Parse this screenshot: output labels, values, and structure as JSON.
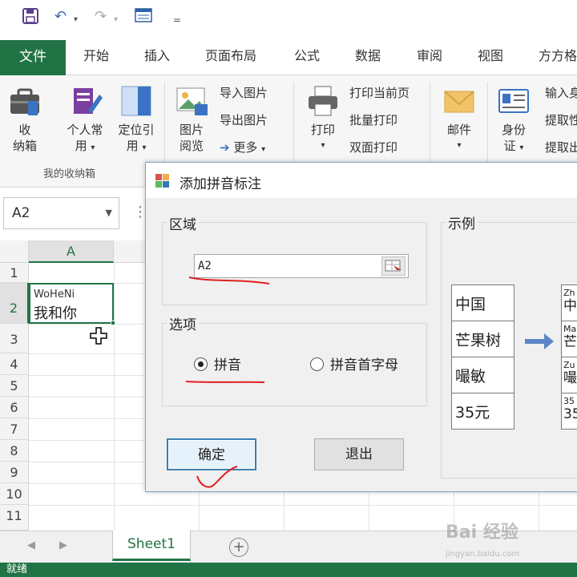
{
  "app": {
    "accent": "#217346",
    "ribbon_tabs": [
      "文件",
      "开始",
      "插入",
      "页面布局",
      "公式",
      "数据",
      "审阅",
      "视图",
      "方方格"
    ],
    "ribbon": {
      "storage_button": "收\n纳箱",
      "storage_button_l1": "收",
      "storage_button_l2": "纳箱",
      "personal_l1": "个人常",
      "personal_l2": "用",
      "locate_l1": "定位引",
      "locate_l2": "用",
      "group_label": "我的收纳箱",
      "picture_l1": "图片",
      "picture_l2": "阅览",
      "import_picture": "导入图片",
      "export_picture": "导出图片",
      "more": "更多",
      "print": "打印",
      "print_current": "打印当前页",
      "batch_print": "批量打印",
      "duplex_print": "双面打印",
      "mail": "邮件",
      "id_l1": "身份",
      "id_l2": "证",
      "input_id": "输入身",
      "extract_1": "提取性",
      "extract_2": "提取出"
    },
    "name_box": "A2",
    "column_headers": [
      "A"
    ],
    "row_numbers": [
      "1",
      "2",
      "3",
      "4",
      "5",
      "6",
      "7",
      "8",
      "9",
      "10",
      "11"
    ],
    "cell_a2": {
      "pinyin": "WoHeNi",
      "text": "我和你"
    },
    "sheet_tab": "Sheet1",
    "status_text": "就绪"
  },
  "dialog": {
    "title": "添加拼音标注",
    "region_legend": "区域",
    "range_value": "A2",
    "options_legend": "选项",
    "option_pinyin": "拼音",
    "option_initials": "拼音首字母",
    "selected_option": "拼音",
    "ok_button": "确定",
    "exit_button": "退出",
    "example_legend": "示例",
    "examples": [
      "中国",
      "芒果树",
      "嘬敏",
      "35元"
    ],
    "example_outputs": [
      {
        "pinyin": "Zh",
        "text": "中"
      },
      {
        "pinyin": "Ma",
        "text": "芒"
      },
      {
        "pinyin": "Zu",
        "text": "嘬"
      },
      {
        "pinyin": "35",
        "text": "35"
      }
    ]
  },
  "watermark": {
    "brand": "Bai 经验",
    "url": "jingyan.baidu.com"
  }
}
